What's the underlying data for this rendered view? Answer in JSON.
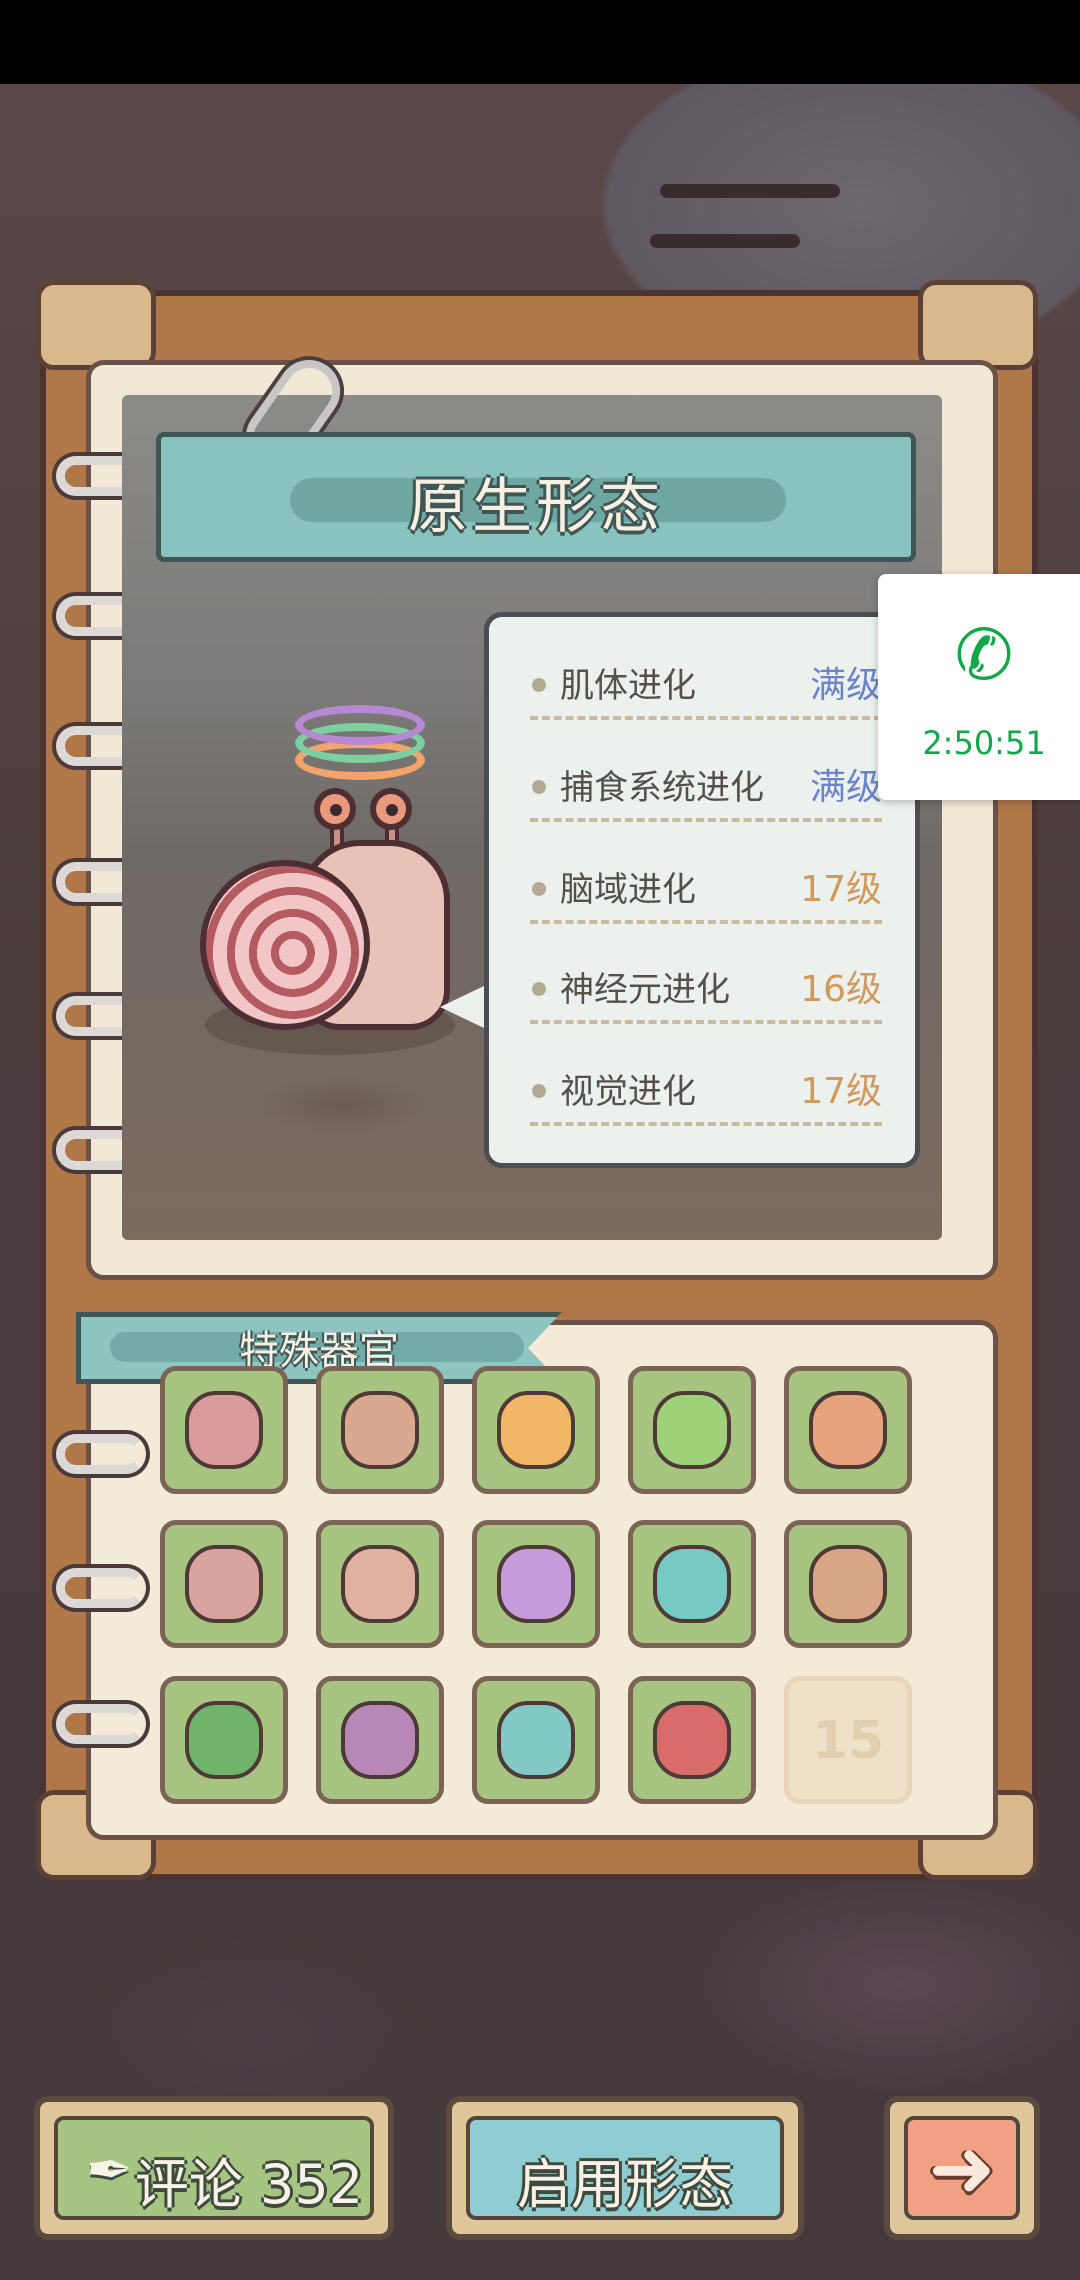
{
  "form_title": "原生形态",
  "evolutions": [
    {
      "name": "肌体进化",
      "level": "满级",
      "color": "#6b83c9"
    },
    {
      "name": "捕食系统进化",
      "level": "满级",
      "color": "#6b83c9"
    },
    {
      "name": "脑域进化",
      "level": "17级",
      "color": "#d09a5c"
    },
    {
      "name": "神经元进化",
      "level": "16级",
      "color": "#d09a5c"
    },
    {
      "name": "视觉进化",
      "level": "17级",
      "color": "#d09a5c"
    }
  ],
  "call": {
    "icon": "phone-icon",
    "time": "2:50:51"
  },
  "organs": {
    "title": "特殊器官",
    "slots": [
      {
        "icon": "fanged-mouth-icon",
        "color": "#d99a9a"
      },
      {
        "icon": "spiked-hide-icon",
        "color": "#d9a98f"
      },
      {
        "icon": "orange-brain-icon",
        "color": "#f1b766"
      },
      {
        "icon": "green-eye-stalk-icon",
        "color": "#9fd07a"
      },
      {
        "icon": "neuron-icon",
        "color": "#e7a27e"
      },
      {
        "icon": "tusked-mouth-icon",
        "color": "#d9a3a0"
      },
      {
        "icon": "striped-hide-icon",
        "color": "#e0b0a0"
      },
      {
        "icon": "purple-brain-icon",
        "color": "#c59bd9"
      },
      {
        "icon": "teal-eye-stalk-icon",
        "color": "#77c9c4"
      },
      {
        "icon": "mechanical-neuron-icon",
        "color": "#d8a585"
      },
      {
        "icon": "eye-cluster-icon",
        "color": "#6fb46a"
      },
      {
        "icon": "horns-icon",
        "color": "#b889b8"
      },
      {
        "icon": "teal-brain-icon",
        "color": "#83c9c6"
      },
      {
        "icon": "red-eye-stalk-icon",
        "color": "#d96b6b"
      }
    ],
    "locked_slot_number": "15"
  },
  "buttons": {
    "comment_label": "评论 352",
    "enable_label": "启用形态",
    "next_icon": "arrow-right-icon"
  }
}
